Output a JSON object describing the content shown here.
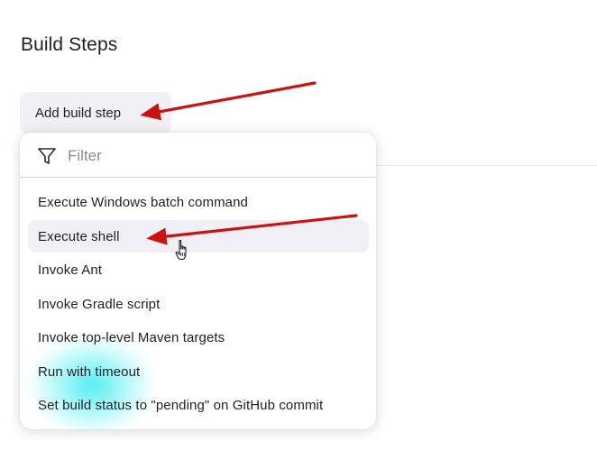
{
  "section": {
    "title": "Build Steps"
  },
  "add_step_button": {
    "label": "Add build step"
  },
  "dropdown": {
    "filter": {
      "icon": "filter-icon",
      "placeholder": "Filter",
      "value": ""
    },
    "items": [
      {
        "label": "Execute Windows batch command",
        "hovered": false
      },
      {
        "label": "Execute shell",
        "hovered": true
      },
      {
        "label": "Invoke Ant",
        "hovered": false
      },
      {
        "label": "Invoke Gradle script",
        "hovered": false
      },
      {
        "label": "Invoke top-level Maven targets",
        "hovered": false
      },
      {
        "label": "Run with timeout",
        "hovered": false
      },
      {
        "label": "Set build status to \"pending\" on GitHub commit",
        "hovered": false
      }
    ]
  },
  "annotations": {
    "arrow_color": "#cc1111",
    "cursor": "hand-pointer-icon"
  },
  "colors": {
    "hover_background": "#efeff5",
    "button_background": "#f1f1f5",
    "text": "#1f1f24",
    "placeholder": "#8b8b95"
  }
}
